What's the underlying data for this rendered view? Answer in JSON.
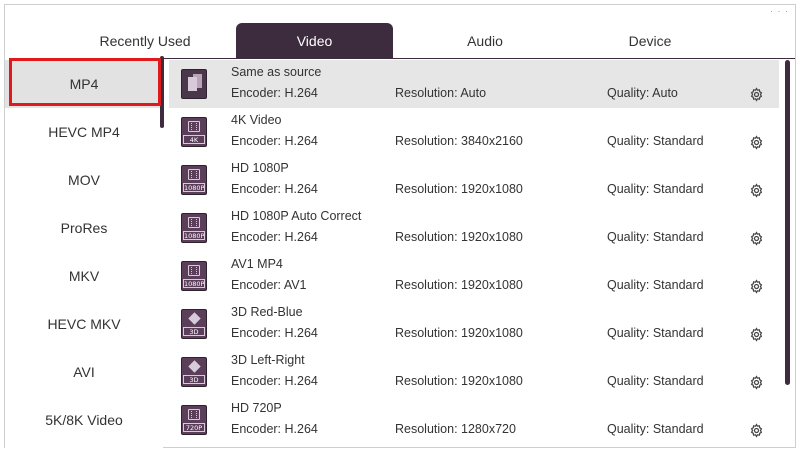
{
  "window": {
    "dots": "· · ·"
  },
  "tabs": [
    {
      "label": "Recently Used"
    },
    {
      "label": "Video"
    },
    {
      "label": "Audio"
    },
    {
      "label": "Device"
    }
  ],
  "active_tab": "Video",
  "sidebar": {
    "items": [
      {
        "label": "MP4"
      },
      {
        "label": "HEVC MP4"
      },
      {
        "label": "MOV"
      },
      {
        "label": "ProRes"
      },
      {
        "label": "MKV"
      },
      {
        "label": "HEVC MKV"
      },
      {
        "label": "AVI"
      },
      {
        "label": "5K/8K Video"
      }
    ],
    "selected": "MP4"
  },
  "presets": [
    {
      "name": "Same as source",
      "encoder": "Encoder: H.264",
      "resolution": "Resolution: Auto",
      "quality": "Quality: Auto",
      "icon": "same-as-source-icon",
      "badge": ""
    },
    {
      "name": "4K Video",
      "encoder": "Encoder: H.264",
      "resolution": "Resolution: 3840x2160",
      "quality": "Quality: Standard",
      "icon": "film-4k-icon",
      "badge": "4K"
    },
    {
      "name": "HD 1080P",
      "encoder": "Encoder: H.264",
      "resolution": "Resolution: 1920x1080",
      "quality": "Quality: Standard",
      "icon": "film-1080p-icon",
      "badge": "1080P"
    },
    {
      "name": "HD 1080P Auto Correct",
      "encoder": "Encoder: H.264",
      "resolution": "Resolution: 1920x1080",
      "quality": "Quality: Standard",
      "icon": "film-1080p-icon",
      "badge": "1080P"
    },
    {
      "name": "AV1 MP4",
      "encoder": "Encoder: AV1",
      "resolution": "Resolution: 1920x1080",
      "quality": "Quality: Standard",
      "icon": "film-1080p-icon",
      "badge": "1080P"
    },
    {
      "name": "3D Red-Blue",
      "encoder": "Encoder: H.264",
      "resolution": "Resolution: 1920x1080",
      "quality": "Quality: Standard",
      "icon": "cube-3d-icon",
      "badge": "3D"
    },
    {
      "name": "3D Left-Right",
      "encoder": "Encoder: H.264",
      "resolution": "Resolution: 1920x1080",
      "quality": "Quality: Standard",
      "icon": "cube-3d-icon",
      "badge": "3D"
    },
    {
      "name": "HD 720P",
      "encoder": "Encoder: H.264",
      "resolution": "Resolution: 1280x720",
      "quality": "Quality: Standard",
      "icon": "film-720p-icon",
      "badge": "720P"
    }
  ],
  "colors": {
    "accent": "#3d2c3d",
    "icon_bg": "#5a3e5a",
    "highlight": "#e0191c",
    "selected_row": "#e6e6e6"
  }
}
